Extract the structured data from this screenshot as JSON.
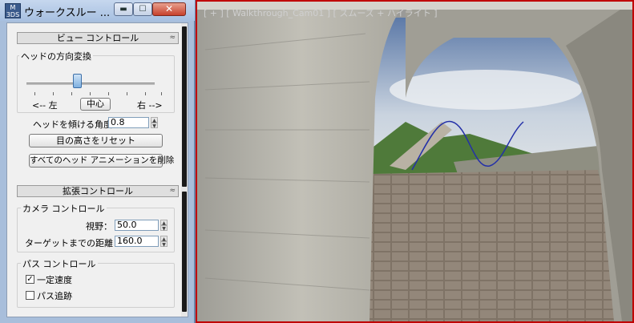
{
  "window": {
    "title": "ウォークスルー ...",
    "app_icon_top": "M",
    "app_icon_bottom": "3DS",
    "min_glyph": "▬",
    "max_glyph": "☐",
    "close_glyph": "✕"
  },
  "view_control": {
    "header": "ビュー コントロール",
    "collapse_glyph": "≈",
    "head_group_label": "ヘッドの方向変換",
    "slider_position": 0.4,
    "left_label": "<-- 左",
    "center_button": "中心",
    "right_label": "右 -->",
    "tilt_label": "ヘッドを傾ける角度",
    "tilt_value": "0.8",
    "reset_eye_button": "目の高さをリセット",
    "delete_anim_button": "すべてのヘッド アニメーションを削除"
  },
  "advanced_control": {
    "header": "拡張コントロール",
    "collapse_glyph": "≈",
    "camera_group_label": "カメラ コントロール",
    "fov_label": "視野：",
    "fov_value": "50.0",
    "target_label": "ターゲットまでの距離：",
    "target_value": "160.0",
    "path_group_label": "パス コントロール",
    "const_speed_label": "一定速度",
    "const_speed_checked": "✓",
    "follow_path_label": "パス追跡"
  },
  "viewport": {
    "label": "[ + ] [ Walkthrough_Cam01 ] [ スムーズ + ハイライト ]",
    "border_color": "#c00000"
  }
}
